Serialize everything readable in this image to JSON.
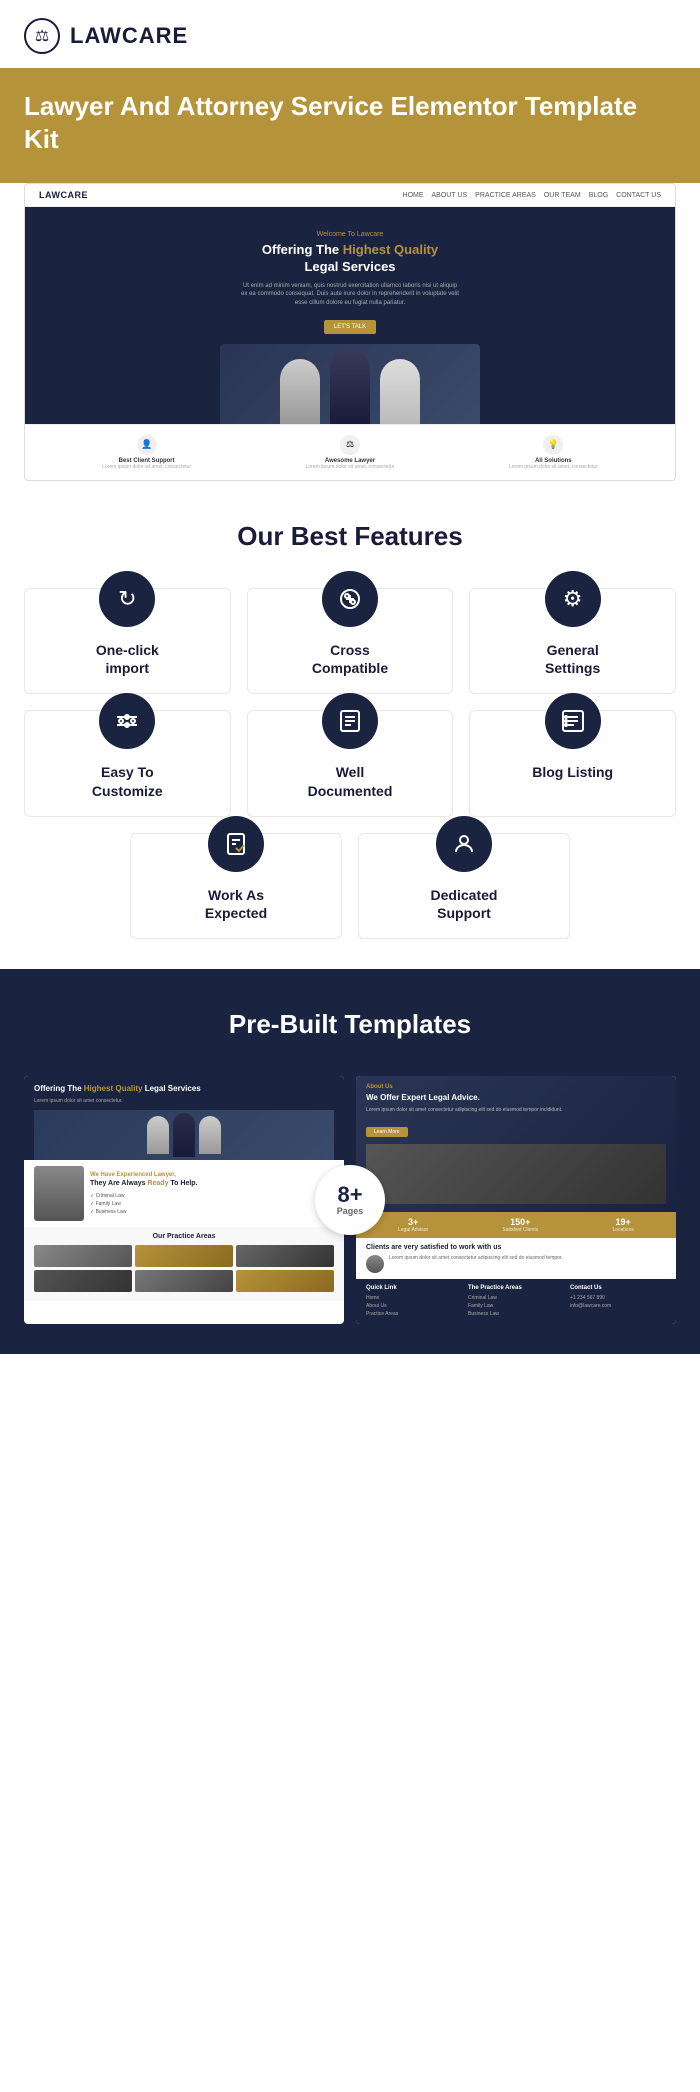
{
  "header": {
    "logo_text": "LAWCARE",
    "logo_icon": "⚖"
  },
  "hero_band": {
    "title": "Lawyer And Attorney Service Elementor Template Kit"
  },
  "preview_nav": {
    "logo": "LAWCARE",
    "links": [
      "HOME",
      "ABOUT US",
      "PRACTICE AREAS",
      "OUR TEAM",
      "BLOG",
      "CONTACT US"
    ]
  },
  "preview_hero": {
    "welcome": "Welcome To Lawcare",
    "title_plain": "Offering The ",
    "title_highlight": "Highest Quality",
    "title_end": " Legal Services",
    "subtitle": "Ut enim ad minim veniam, quis nostrud exercitation ullamco laboris nisi ut aliquip ex ea commodo consequat. Duis aute irure dolor in reprehenderit in voluptate velit esse cillum dolore eu fugiat nulla pariatur.",
    "cta": "LET'S TALK"
  },
  "preview_bottom": {
    "items": [
      {
        "icon": "👤",
        "label": "Best Client Support",
        "sub": "Lorem ipsum dolor sit amet, consectetur"
      },
      {
        "icon": "⚖",
        "label": "Awesome Lawyer",
        "sub": "Lorem ipsum dolor sit amet, consectetur"
      },
      {
        "icon": "💡",
        "label": "All Solutions",
        "sub": "Lorem ipsum dolor sit amet, consectetur"
      }
    ]
  },
  "features_section": {
    "title": "Our Best Features",
    "features": [
      {
        "icon": "↻",
        "label": "One-click\nimport"
      },
      {
        "icon": "⊕",
        "label": "Cross\nCompatible"
      },
      {
        "icon": "⚙",
        "label": "General\nSettings"
      },
      {
        "icon": "≡",
        "label": "Easy To\nCustomize"
      },
      {
        "icon": "📄",
        "label": "Well\nDocumented"
      },
      {
        "icon": "☰",
        "label": "Blog Listing"
      }
    ],
    "features_bottom": [
      {
        "icon": "✓",
        "label": "Work As\nExpected"
      },
      {
        "icon": "👤",
        "label": "Dedicated\nSupport"
      }
    ]
  },
  "prebuilt_section": {
    "title": "Pre-Built Templates",
    "pages_count": "8+",
    "pages_label": "Pages"
  },
  "template_left": {
    "hero_title_plain": "Offering The ",
    "hero_title_highlight": "Highest Quality",
    "hero_title_end": " Legal Services",
    "hero_sub": "Lorem ipsum dolor sit amet consectetur adipiscing.",
    "lawyer_label": "We Have Experienced Lawyer,",
    "lawyer_title": "They Are Always Ready To Help.",
    "practice_title": "Our Practice Areas"
  },
  "template_right": {
    "about_label": "About Us",
    "advice_title": "We Offer Expert Legal Advice.",
    "advice_text": "Lorem ipsum dolor sit amet consectetur adipiscing elit sed do eiusmod tempor incididunt.",
    "cta": "Learn More",
    "stats": [
      {
        "num": "3+",
        "label": "Legal Advisor"
      },
      {
        "num": "150+",
        "label": "Satisfied Clients"
      },
      {
        "num": "19+",
        "label": "Locations"
      }
    ],
    "test_title": "Clients are very satisfied to work with us",
    "footer_cols": [
      {
        "title": "Quick Link",
        "links": [
          "Home",
          "About Us",
          "Practice Areas"
        ]
      },
      {
        "title": "The Practice Areas",
        "links": [
          "Criminal Law",
          "Family Law",
          "Business Law"
        ]
      },
      {
        "title": "Contact Us",
        "links": [
          "+1 234 567 890",
          "info@lawcare.com"
        ]
      }
    ]
  }
}
